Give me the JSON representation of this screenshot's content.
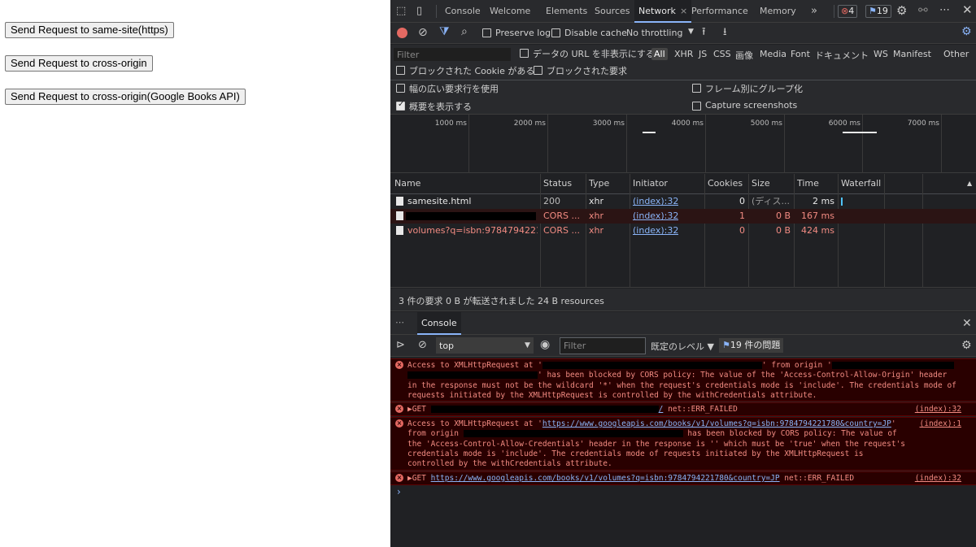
{
  "page": {
    "buttons": [
      "Send Request to same-site(https)",
      "Send Request to cross-origin",
      "Send Request to cross-origin(Google Books API)"
    ]
  },
  "devtools": {
    "tabs": [
      "Console",
      "Welcome",
      "Elements",
      "Sources",
      "Network",
      "Performance",
      "Memory"
    ],
    "active_tab": "Network",
    "more_tabs": "»",
    "error_count": "4",
    "issue_count": "19",
    "toolbar": {
      "preserve_log": "Preserve log",
      "disable_cache": "Disable cache",
      "throttling": "No throttling"
    },
    "filter": {
      "placeholder": "Filter",
      "hide_data_urls": "データの URL を非表示にする",
      "types": [
        "All",
        "XHR",
        "JS",
        "CSS",
        "画像",
        "Media",
        "Font",
        "ドキュメント",
        "WS",
        "Manifest",
        "Other"
      ],
      "blocked_cookies": "ブロックされた Cookie がある",
      "blocked_requests": "ブロックされた要求",
      "large_rows": "幅の広い要求行を使用",
      "group_by_frame": "フレーム別にグループ化",
      "show_overview": "概要を表示する",
      "capture_screenshots": "Capture screenshots"
    },
    "timeline_ticks": [
      "1000 ms",
      "2000 ms",
      "3000 ms",
      "4000 ms",
      "5000 ms",
      "6000 ms",
      "7000 ms"
    ],
    "columns": [
      "Name",
      "Status",
      "Type",
      "Initiator",
      "Cookies",
      "Size",
      "Time",
      "Waterfall"
    ],
    "sort_arrow": "▲",
    "requests": [
      {
        "name": "samesite.html",
        "status": "200",
        "type": "xhr",
        "initiator": "(index):32",
        "cookies": "0",
        "size": "(ディス...",
        "time": "2 ms",
        "error": false
      },
      {
        "name": "",
        "status": "CORS ...",
        "type": "xhr",
        "initiator": "(index):32",
        "cookies": "1",
        "size": "0 B",
        "time": "167 ms",
        "error": true
      },
      {
        "name": "volumes?q=isbn:978479422178...",
        "status": "CORS ...",
        "type": "xhr",
        "initiator": "(index):32",
        "cookies": "0",
        "size": "0 B",
        "time": "424 ms",
        "error": true
      }
    ],
    "summary": "3 件の要求   0 B が転送されました   24 B resources",
    "drawer": {
      "more": "⋯",
      "tab": "Console",
      "context": "top",
      "filter_placeholder": "Filter",
      "levels": "既定のレベル ▼",
      "issues": "19 件の問題"
    },
    "console_messages": [
      {
        "prefix": "Access to XMLHttpRequest at '",
        "mid1": "' from origin '",
        "mid2": "' has been blocked by CORS policy: The value of the 'Access-Control-Allow-Origin' header in the response must not be the wildcard '*' when the request's credentials mode is 'include'. The credentials mode of requests initiated by the XMLHttpRequest is controlled by the withCredentials attribute.",
        "source": ""
      },
      {
        "prefix": "▶GET ",
        "link": "/",
        "suffix": " net::ERR_FAILED",
        "source": "(index):32"
      },
      {
        "prefix": "Access to XMLHttpRequest at '",
        "link": "https://www.googleapis.com/books/v1/volumes?q=isbn:9784794221780&country=JP",
        "mid1": "'",
        "from": "from origin",
        "mid2": "has been blocked by CORS policy: The value of the 'Access-Control-Allow-Credentials' header in the response is '' which must be 'true' when the request's credentials mode is 'include'. The credentials mode of requests initiated by the XMLHttpRequest is controlled by the withCredentials attribute.",
        "source": "(index):1"
      },
      {
        "prefix": "▶GET ",
        "link": "https://www.googleapis.com/books/v1/volumes?q=isbn:9784794221780&country=JP",
        "suffix": " net::ERR_FAILED",
        "source": "(index):32"
      }
    ],
    "prompt": "›",
    "colors": {
      "accent": "#8ab4f8",
      "error": "#f28b82",
      "record": "#e46962",
      "bg": "#202124"
    }
  }
}
